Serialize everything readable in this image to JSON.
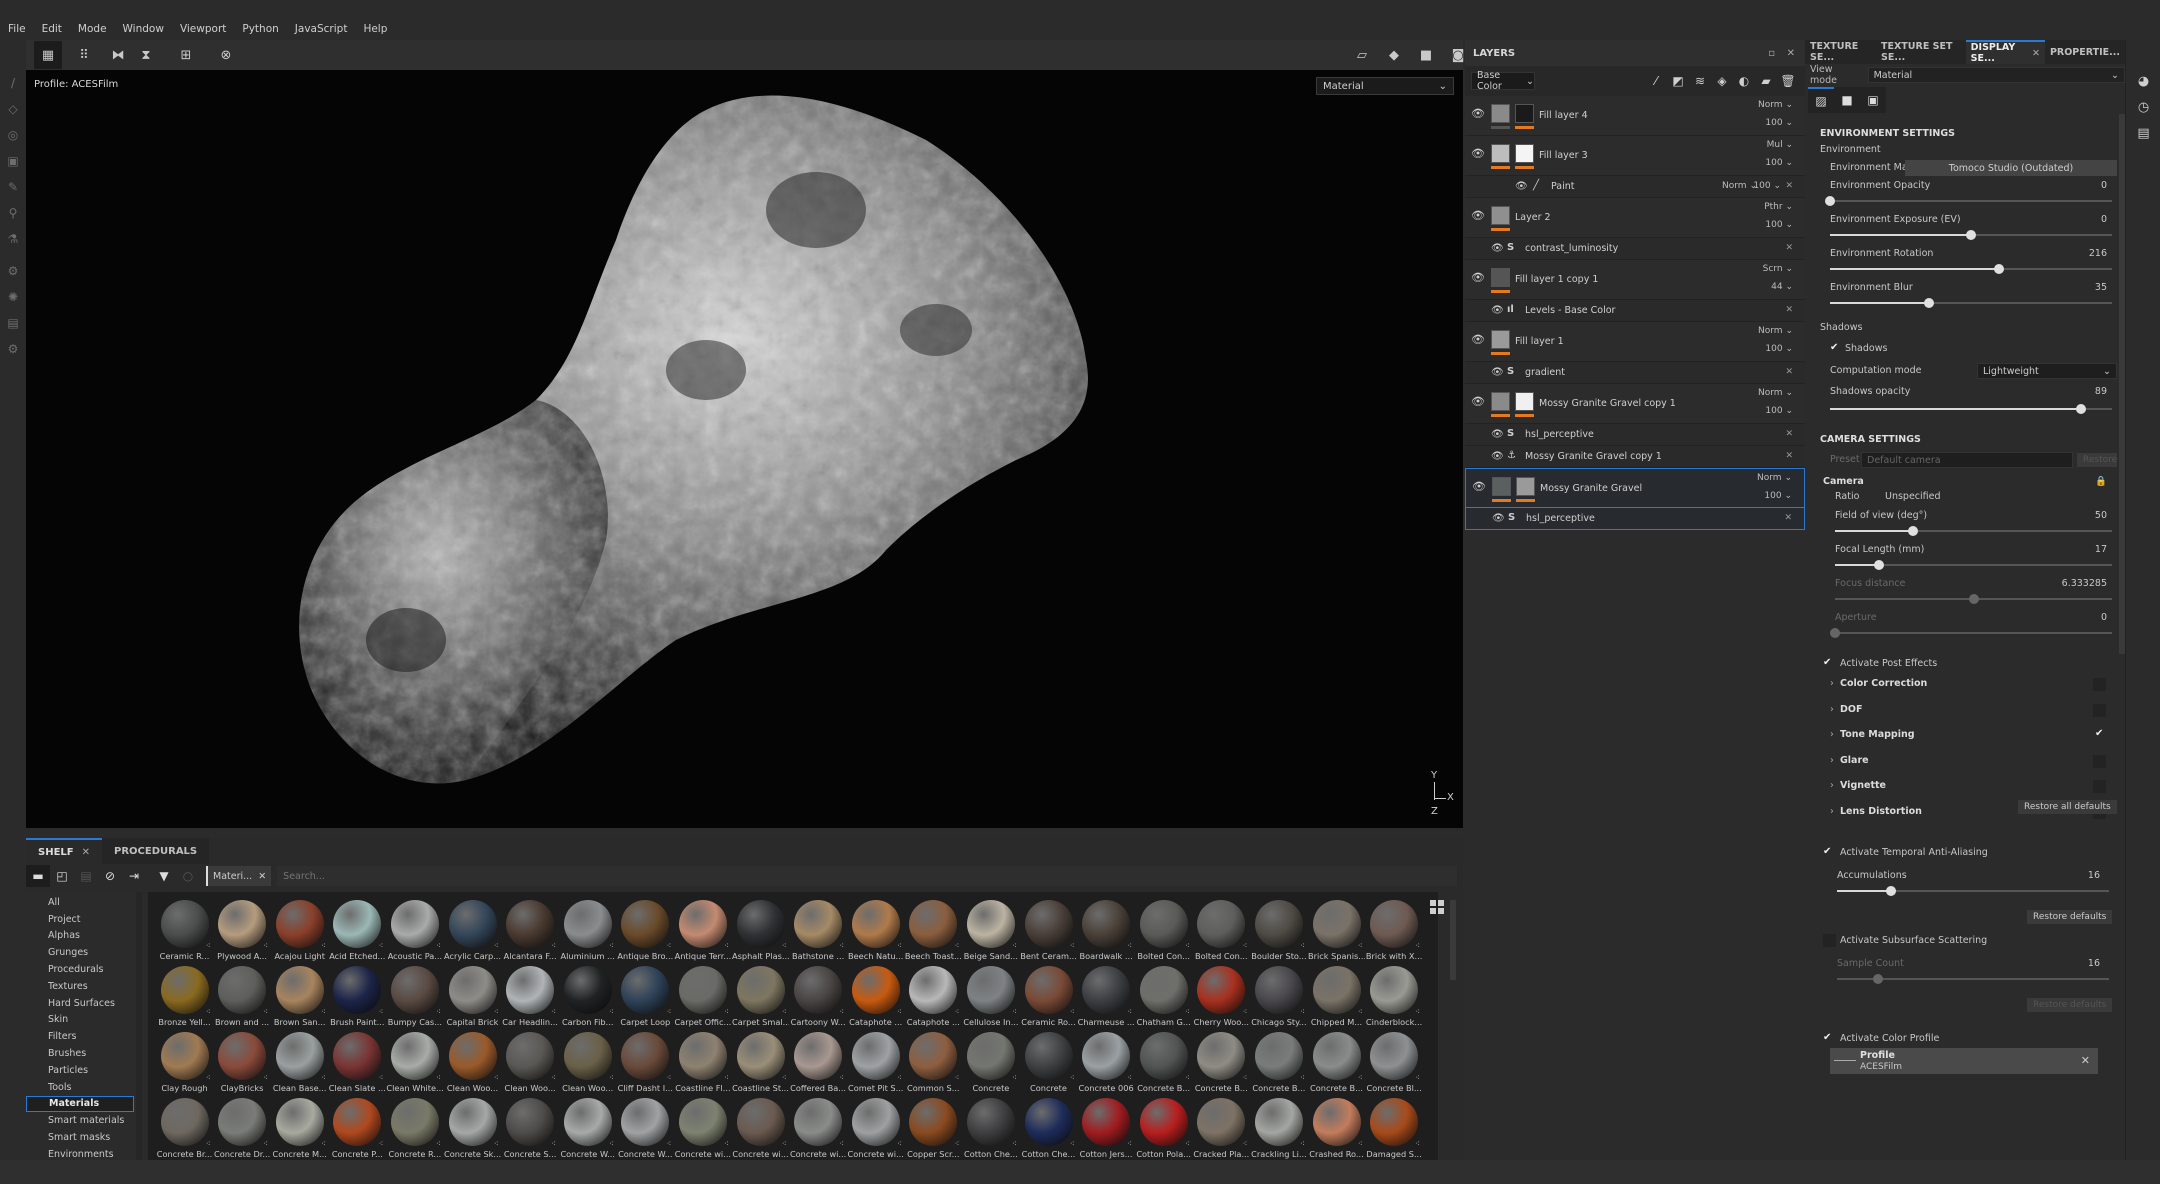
{
  "menu": [
    "File",
    "Edit",
    "Mode",
    "Window",
    "Viewport",
    "Python",
    "JavaScript",
    "Help"
  ],
  "toolbar": {
    "icons": [
      "grid-select-icon",
      "grid-options-icon",
      "symmetry-x-icon",
      "symmetry-y-icon",
      "add-frame-icon",
      "history-icon"
    ],
    "viewport_icons": [
      "perspective-icon",
      "cube-icon",
      "camera-icon",
      "screenshot-icon"
    ]
  },
  "viewport": {
    "profile_label": "Profile: ACESFilm",
    "view_mode": "Material",
    "axis_y": "Y",
    "axis_x": "X",
    "axis_z": "Z"
  },
  "shelf": {
    "tabs": [
      {
        "label": "SHELF",
        "active": true
      },
      {
        "label": "PROCEDURALS",
        "active": false
      }
    ],
    "filter_chip": "Materi...",
    "search_placeholder": "Search...",
    "categories": [
      "All",
      "Project",
      "Alphas",
      "Grunges",
      "Procedurals",
      "Textures",
      "Hard Surfaces",
      "Skin",
      "Filters",
      "Brushes",
      "Particles",
      "Tools",
      "Materials",
      "Smart materials",
      "Smart masks",
      "Environments"
    ],
    "selected_category": "Materials",
    "materials": [
      [
        "Ceramic R...",
        "Plywood A...",
        "Acajou Light",
        "Acid Etched...",
        "Acoustic Pa...",
        "Acrylic Carp...",
        "Alcantara F...",
        "Aluminium ...",
        "Antique Bro...",
        "Antique Terr...",
        "Asphalt Plas...",
        "Bathstone ...",
        "Beech Natu...",
        "Beech Toast...",
        "Beige Sand...",
        "Bent Ceram...",
        "Boardwalk ...",
        "Bolted Con...",
        "Bolted Con...",
        "Boulder Sto...",
        "Brick Spanis...",
        "Brick with X..."
      ],
      [
        "Bronze Yell...",
        "Brown and ...",
        "Brown San...",
        "Brush Paint...",
        "Bumpy Cas...",
        "Capital Brick",
        "Car Headlin...",
        "Carbon Fib...",
        "Carpet Loop",
        "Carpet Offic...",
        "Carpet Smal...",
        "Cartoony W...",
        "Cataphote ...",
        "Cataphote ...",
        "Cellulose In...",
        "Ceramic Ro...",
        "Charmeuse ...",
        "Chatham G...",
        "Cherry Woo...",
        "Chicago Sty...",
        "Chipped M...",
        "Cinderblock..."
      ],
      [
        "Clay Rough",
        "ClayBricks",
        "Clean Base...",
        "Clean Slate ...",
        "Clean White...",
        "Clean Woo...",
        "Clean Woo...",
        "Clean Woo...",
        "Cliff Dasht I...",
        "Coastline Fl...",
        "Coastline St...",
        "Coffered Ba...",
        "Comet Pit S...",
        "Common S...",
        "Concrete",
        "Concrete",
        "Concrete 006",
        "Concrete B...",
        "Concrete B...",
        "Concrete B...",
        "Concrete B...",
        "Concrete Bl..."
      ],
      [
        "Concrete Br...",
        "Concrete Dr...",
        "Concrete M...",
        "Concrete P...",
        "Concrete R...",
        "Concrete Sk...",
        "Concrete S...",
        "Concrete W...",
        "Concrete W...",
        "Concrete wi...",
        "Concrete wi...",
        "Concrete wi...",
        "Concrete wi...",
        "Copper Scr...",
        "Cotton Che...",
        "Cotton Che...",
        "Cotton Jers...",
        "Cotton Pola...",
        "Cracked Pla...",
        "Crackling Li...",
        "Crashed Ro...",
        "Damaged S..."
      ]
    ],
    "material_colors": [
      [
        "#4a4d4c",
        "#b59c7e",
        "#8a3f2a",
        "#9bb8b6",
        "#a9abaa",
        "#34465a",
        "#4a3a30",
        "#8a8c8e",
        "#6a4a2a",
        "#c48a70",
        "#2f3134",
        "#a58a65",
        "#b07a4a",
        "#8a5e3e",
        "#bcb3a3",
        "#4a3f38",
        "#4a4038",
        "#5a5a58",
        "#5e5e5c",
        "#4e4a44",
        "#7a7268",
        "#6e5a52"
      ],
      [
        "#8a6a20",
        "#5e5e5c",
        "#a8845e",
        "#1c2448",
        "#5a4a42",
        "#8e8c88",
        "#b0b4b6",
        "#202224",
        "#2e4258",
        "#6a6a66",
        "#7e7660",
        "#4a4444",
        "#c85a10",
        "#b8b8b8",
        "#7e8284",
        "#7a4a36",
        "#3c3e42",
        "#6e6e6a",
        "#a8301e",
        "#48464a",
        "#7a7266",
        "#9a9a94"
      ],
      [
        "#a07a52",
        "#8a4a3a",
        "#9aa0a0",
        "#7a3434",
        "#a8aca8",
        "#9a5a2a",
        "#5a5854",
        "#6a6048",
        "#6a4a3a",
        "#8e8270",
        "#9a8e78",
        "#a89890",
        "#9ea2a4",
        "#8e5e40",
        "#747670",
        "#3e4042",
        "#9aa0a4",
        "#525454",
        "#8e8c84",
        "#7a7c7c",
        "#8a8c8c",
        "#8e9092"
      ],
      [
        "#6e6860",
        "#7a7c78",
        "#a8aaa0",
        "#b0481e",
        "#7a7a68",
        "#a6a8a8",
        "#4e4c4a",
        "#a8aaaa",
        "#a0a2a4",
        "#7e8270",
        "#6a5a50",
        "#8a8c8a",
        "#9ea0a2",
        "#8a4a20",
        "#3e3e40",
        "#1e2c5a",
        "#a01c20",
        "#b81e1e",
        "#7e7264",
        "#a4a6a2",
        "#c47c5c",
        "#a84a1a"
      ]
    ]
  },
  "layers": {
    "title": "LAYERS",
    "channel": "Base Color",
    "tool_icons": [
      "magic-wand-icon",
      "add-mask-icon",
      "add-layer-icon",
      "add-fill-icon",
      "add-effect-icon",
      "add-folder-icon",
      "delete-icon"
    ],
    "items": [
      {
        "type": "layer",
        "name": "Fill layer 4",
        "blend": "Norm",
        "opacity": "100",
        "thumb1": "#8a8a8a",
        "thumb2": "#1a1a1a",
        "bar1": "grey",
        "bar2": "orange",
        "two": true
      },
      {
        "type": "layer",
        "name": "Fill layer 3",
        "blend": "Mul",
        "opacity": "100",
        "thumb1": "#bdbdbd",
        "thumb2": "#f4f4f4",
        "bar1": "orange",
        "bar2": "orange",
        "two": true
      },
      {
        "type": "paint",
        "name": "Paint",
        "blend": "Norm",
        "opacity": "100"
      },
      {
        "type": "layer",
        "name": "Layer 2",
        "blend": "Pthr",
        "opacity": "100",
        "thumb1": "#8f8f8f",
        "bar1": "orange",
        "two": false
      },
      {
        "type": "sub",
        "icon": "substance-icon",
        "name": "contrast_luminosity"
      },
      {
        "type": "layer",
        "name": "Fill layer 1 copy 1",
        "blend": "Scrn",
        "opacity": "44",
        "thumb1": "#555",
        "bar1": "orange",
        "two": false
      },
      {
        "type": "sub",
        "icon": "levels-icon",
        "name": "Levels - Base Color"
      },
      {
        "type": "layer",
        "name": "Fill layer 1",
        "blend": "Norm",
        "opacity": "100",
        "thumb1": "#9a9a9a",
        "bar1": "orange",
        "two": false
      },
      {
        "type": "sub",
        "icon": "substance-icon",
        "name": "gradient"
      },
      {
        "type": "layer",
        "name": "Mossy Granite Gravel copy 1",
        "blend": "Norm",
        "opacity": "100",
        "thumb1": "#8a8a8a",
        "thumb2": "#f0f0f0",
        "bar1": "orange",
        "bar2": "orange",
        "two": true
      },
      {
        "type": "sub",
        "icon": "substance-icon",
        "name": "hsl_perceptive"
      },
      {
        "type": "sub",
        "icon": "anchor-icon",
        "name": "Mossy Granite Gravel copy 1"
      },
      {
        "type": "layer",
        "name": "Mossy Granite Gravel",
        "blend": "Norm",
        "opacity": "100",
        "thumb1": "#5a6060",
        "thumb2": "#9a9a9a",
        "bar1": "orange",
        "bar2": "orange",
        "two": true,
        "selected": true
      },
      {
        "type": "sub",
        "icon": "substance-icon",
        "name": "hsl_perceptive",
        "selected": true
      }
    ]
  },
  "properties": {
    "tabs": [
      {
        "label": "TEXTURE SE...",
        "active": false
      },
      {
        "label": "TEXTURE SET SE...",
        "active": false
      },
      {
        "label": "DISPLAY SE...",
        "active": true,
        "closable": true
      },
      {
        "label": "PROPERTIE...",
        "active": false
      }
    ],
    "view_mode_label": "View mode",
    "view_mode_value": "Material",
    "environment_settings": "ENVIRONMENT SETTINGS",
    "environment": "Environment",
    "env_map_label": "Environment Map",
    "env_map_value": "Tomoco Studio (Outdated)",
    "env_opacity_label": "Environment Opacity",
    "env_opacity_value": "0",
    "env_opacity_fraction": 0.0,
    "env_exposure_label": "Environment Exposure (EV)",
    "env_exposure_value": "0",
    "env_exposure_fraction": 0.5,
    "env_rotation_label": "Environment Rotation",
    "env_rotation_value": "216",
    "env_rotation_fraction": 0.6,
    "env_blur_label": "Environment Blur",
    "env_blur_value": "35",
    "env_blur_fraction": 0.35,
    "shadows_header": "Shadows",
    "shadows_check": "Shadows",
    "computation_mode_label": "Computation mode",
    "computation_mode_value": "Lightweight",
    "shadows_opacity_label": "Shadows opacity",
    "shadows_opacity_value": "89",
    "shadows_opacity_fraction": 0.89,
    "camera_settings": "CAMERA SETTINGS",
    "preset_label": "Preset",
    "preset_value": "Default camera",
    "restore_label": "Restore",
    "camera_header": "Camera",
    "ratio_label": "Ratio",
    "ratio_value": "Unspecified",
    "fov_label": "Field of view (deg°)",
    "fov_value": "50",
    "fov_fraction": 0.28,
    "focal_label": "Focal Length (mm)",
    "focal_value": "17",
    "focal_fraction": 0.16,
    "focus_label": "Focus distance",
    "focus_value": "6.333285",
    "focus_fraction": 0.5,
    "aperture_label": "Aperture",
    "aperture_value": "0",
    "aperture_fraction": 0.0,
    "post_effects_label": "Activate Post Effects",
    "effects": [
      {
        "label": "Color Correction",
        "checked": false
      },
      {
        "label": "DOF",
        "checked": false
      },
      {
        "label": "Tone Mapping",
        "checked": true
      },
      {
        "label": "Glare",
        "checked": false
      },
      {
        "label": "Vignette",
        "checked": false
      },
      {
        "label": "Lens Distortion",
        "checked": false
      }
    ],
    "restore_all_defaults": "Restore all defaults",
    "taa_label": "Activate Temporal Anti-Aliasing",
    "accumulations_label": "Accumulations",
    "accumulations_value": "16",
    "accumulations_fraction": 0.2,
    "restore_defaults": "Restore defaults",
    "sss_label": "Activate Subsurface Scattering",
    "sample_count_label": "Sample Count",
    "sample_count_value": "16",
    "sample_count_fraction": 0.15,
    "color_profile_label": "Activate Color Profile",
    "profile_title": "Profile",
    "profile_value": "ACESFilm"
  },
  "right_strip": [
    "environment-icon",
    "history-icon",
    "log-icon"
  ]
}
